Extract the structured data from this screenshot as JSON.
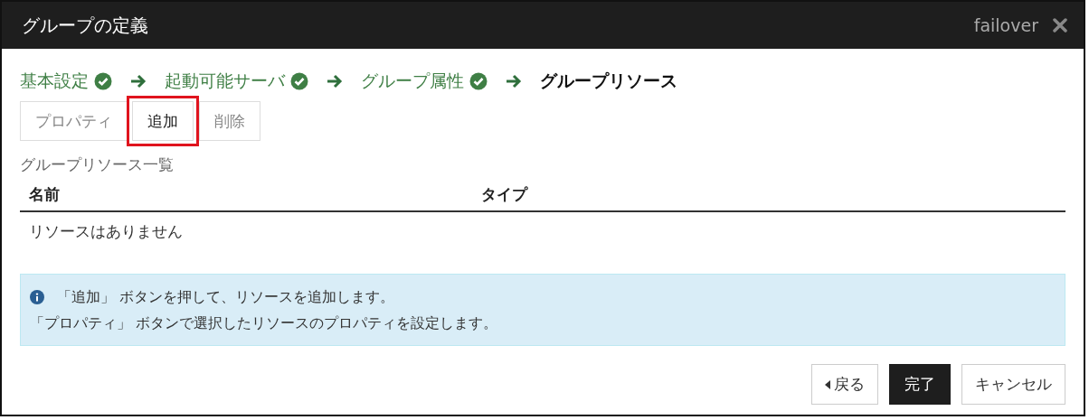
{
  "window": {
    "title": "グループの定義",
    "context": "failover"
  },
  "steps": [
    {
      "label": "基本設定",
      "completed": true
    },
    {
      "label": "起動可能サーバ",
      "completed": true
    },
    {
      "label": "グループ属性",
      "completed": true
    },
    {
      "label": "グループリソース",
      "completed": false
    }
  ],
  "toolbar": [
    {
      "label": "プロパティ",
      "disabled": true,
      "highlighted": false
    },
    {
      "label": "追加",
      "disabled": false,
      "highlighted": true
    },
    {
      "label": "削除",
      "disabled": true,
      "highlighted": false
    }
  ],
  "list": {
    "title": "グループリソース一覧",
    "columns": [
      "名前",
      "タイプ"
    ],
    "empty_message": "リソースはありません"
  },
  "info": {
    "lines": [
      "「追加」 ボタンを押して、リソースを追加します。",
      "「プロパティ」 ボタンで選択したリソースのプロパティを設定します。"
    ]
  },
  "buttons": [
    {
      "label": "戻る",
      "kind": "back"
    },
    {
      "label": "完了",
      "kind": "primary"
    },
    {
      "label": "キャンセル",
      "kind": "default"
    }
  ]
}
